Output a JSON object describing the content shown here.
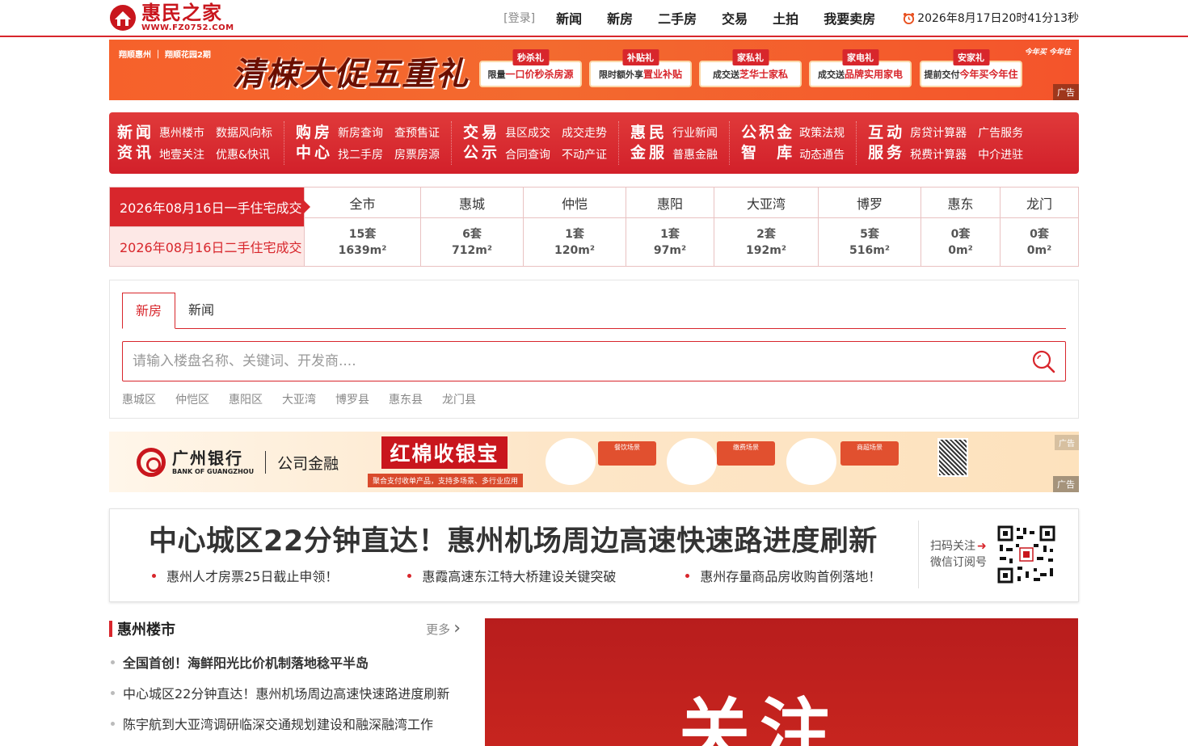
{
  "header": {
    "logo_cn": "惠民之家",
    "logo_url": "WWW.FZ0752.COM",
    "login": "[登录]",
    "nav": [
      "新闻",
      "新房",
      "二手房",
      "交易",
      "土拍",
      "我要卖房"
    ],
    "clock": "2026年8月17日20时41分13秒"
  },
  "ad_top": {
    "brands": "翔顺惠州 ｜ 翔顺花园2期",
    "slogan": "清梀大促五重礼",
    "gifts": [
      {
        "tag": "秒杀礼",
        "pre": "限量",
        "hl": "一口价秒杀房源"
      },
      {
        "tag": "补贴礼",
        "pre": "限时额外享",
        "hl": "置业补贴"
      },
      {
        "tag": "家私礼",
        "pre": "成交送",
        "hl": "芝华士家私"
      },
      {
        "tag": "家电礼",
        "pre": "成交送",
        "hl": "品牌实用家电"
      },
      {
        "tag": "安家礼",
        "pre": "提前交付",
        "hl": "今年买今年住"
      }
    ],
    "corner": "今年买 今年住",
    "flag": "广告"
  },
  "main_nav": [
    {
      "title1": "新闻",
      "title2": "资讯",
      "links": [
        "惠州楼市",
        "地壹关注",
        "数据风向标",
        "优惠&快讯"
      ]
    },
    {
      "title1": "购房",
      "title2": "中心",
      "links": [
        "新房查询",
        "找二手房",
        "查预售证",
        "房票房源"
      ]
    },
    {
      "title1": "交易",
      "title2": "公示",
      "links": [
        "县区成交",
        "合同查询",
        "成交走势",
        "不动产证"
      ]
    },
    {
      "title1": "惠民",
      "title2": "金服",
      "links": [
        "行业新闻",
        "普惠金融"
      ]
    },
    {
      "title1": "公积金",
      "title2": "智　库",
      "links": [
        "政策法规",
        "动态通告"
      ]
    },
    {
      "title1": "互动",
      "title2": "服务",
      "links": [
        "房贷计算器",
        "税费计算器",
        "广告服务",
        "中介进驻"
      ]
    }
  ],
  "deals": {
    "row1_label": "2026年08月16日一手住宅成交",
    "row2_label": "2026年08月16日二手住宅成交",
    "columns": [
      {
        "name": "全市",
        "units": "15套",
        "area": "1639m²"
      },
      {
        "name": "惠城",
        "units": "6套",
        "area": "712m²"
      },
      {
        "name": "仲恺",
        "units": "1套",
        "area": "120m²"
      },
      {
        "name": "惠阳",
        "units": "1套",
        "area": "97m²"
      },
      {
        "name": "大亚湾",
        "units": "2套",
        "area": "192m²"
      },
      {
        "name": "博罗",
        "units": "5套",
        "area": "516m²"
      },
      {
        "name": "惠东",
        "units": "0套",
        "area": "0m²"
      },
      {
        "name": "龙门",
        "units": "0套",
        "area": "0m²"
      }
    ]
  },
  "search": {
    "tabs": [
      "新房",
      "新闻"
    ],
    "placeholder": "请输入楼盘名称、关键词、开发商....",
    "districts": [
      "惠城区",
      "仲恺区",
      "惠阳区",
      "大亚湾",
      "博罗县",
      "惠东县",
      "龙门县"
    ]
  },
  "ad_bank": {
    "bank_cn": "广州银行",
    "bank_en": "BANK OF GUANGZHOU",
    "biz": "公司金融",
    "title": "红棉收银宝",
    "subtitle": "聚合支付收单产品，支持多场景、多行业应用",
    "scenes": [
      "餐饮场景",
      "缴费场景",
      "商超场景"
    ],
    "flag": "广告",
    "flag_small": "广告"
  },
  "headline": {
    "title": "中心城区22分钟直达！惠州机场周边高速快速路进度刷新",
    "subs": [
      "惠州人才房票25日截止申领！",
      "惠霞高速东江特大桥建设关键突破",
      "惠州存量商品房收购首例落地！"
    ],
    "qr_line1": "扫码关注",
    "qr_line2": "微信订阅号"
  },
  "market": {
    "title": "惠州楼市",
    "more": "更多",
    "items": [
      "全国首创！海鲜阳光比价机制落地稔平半岛",
      "中心城区22分钟直达！惠州机场周边高速快速路进度刷新",
      "陈宇航到大亚湾调研临深交通规划建设和融深融湾工作"
    ]
  },
  "focus": {
    "text": "关注"
  },
  "colors": {
    "brand_red": "#d8262c",
    "light_pink": "#fde8e6"
  }
}
